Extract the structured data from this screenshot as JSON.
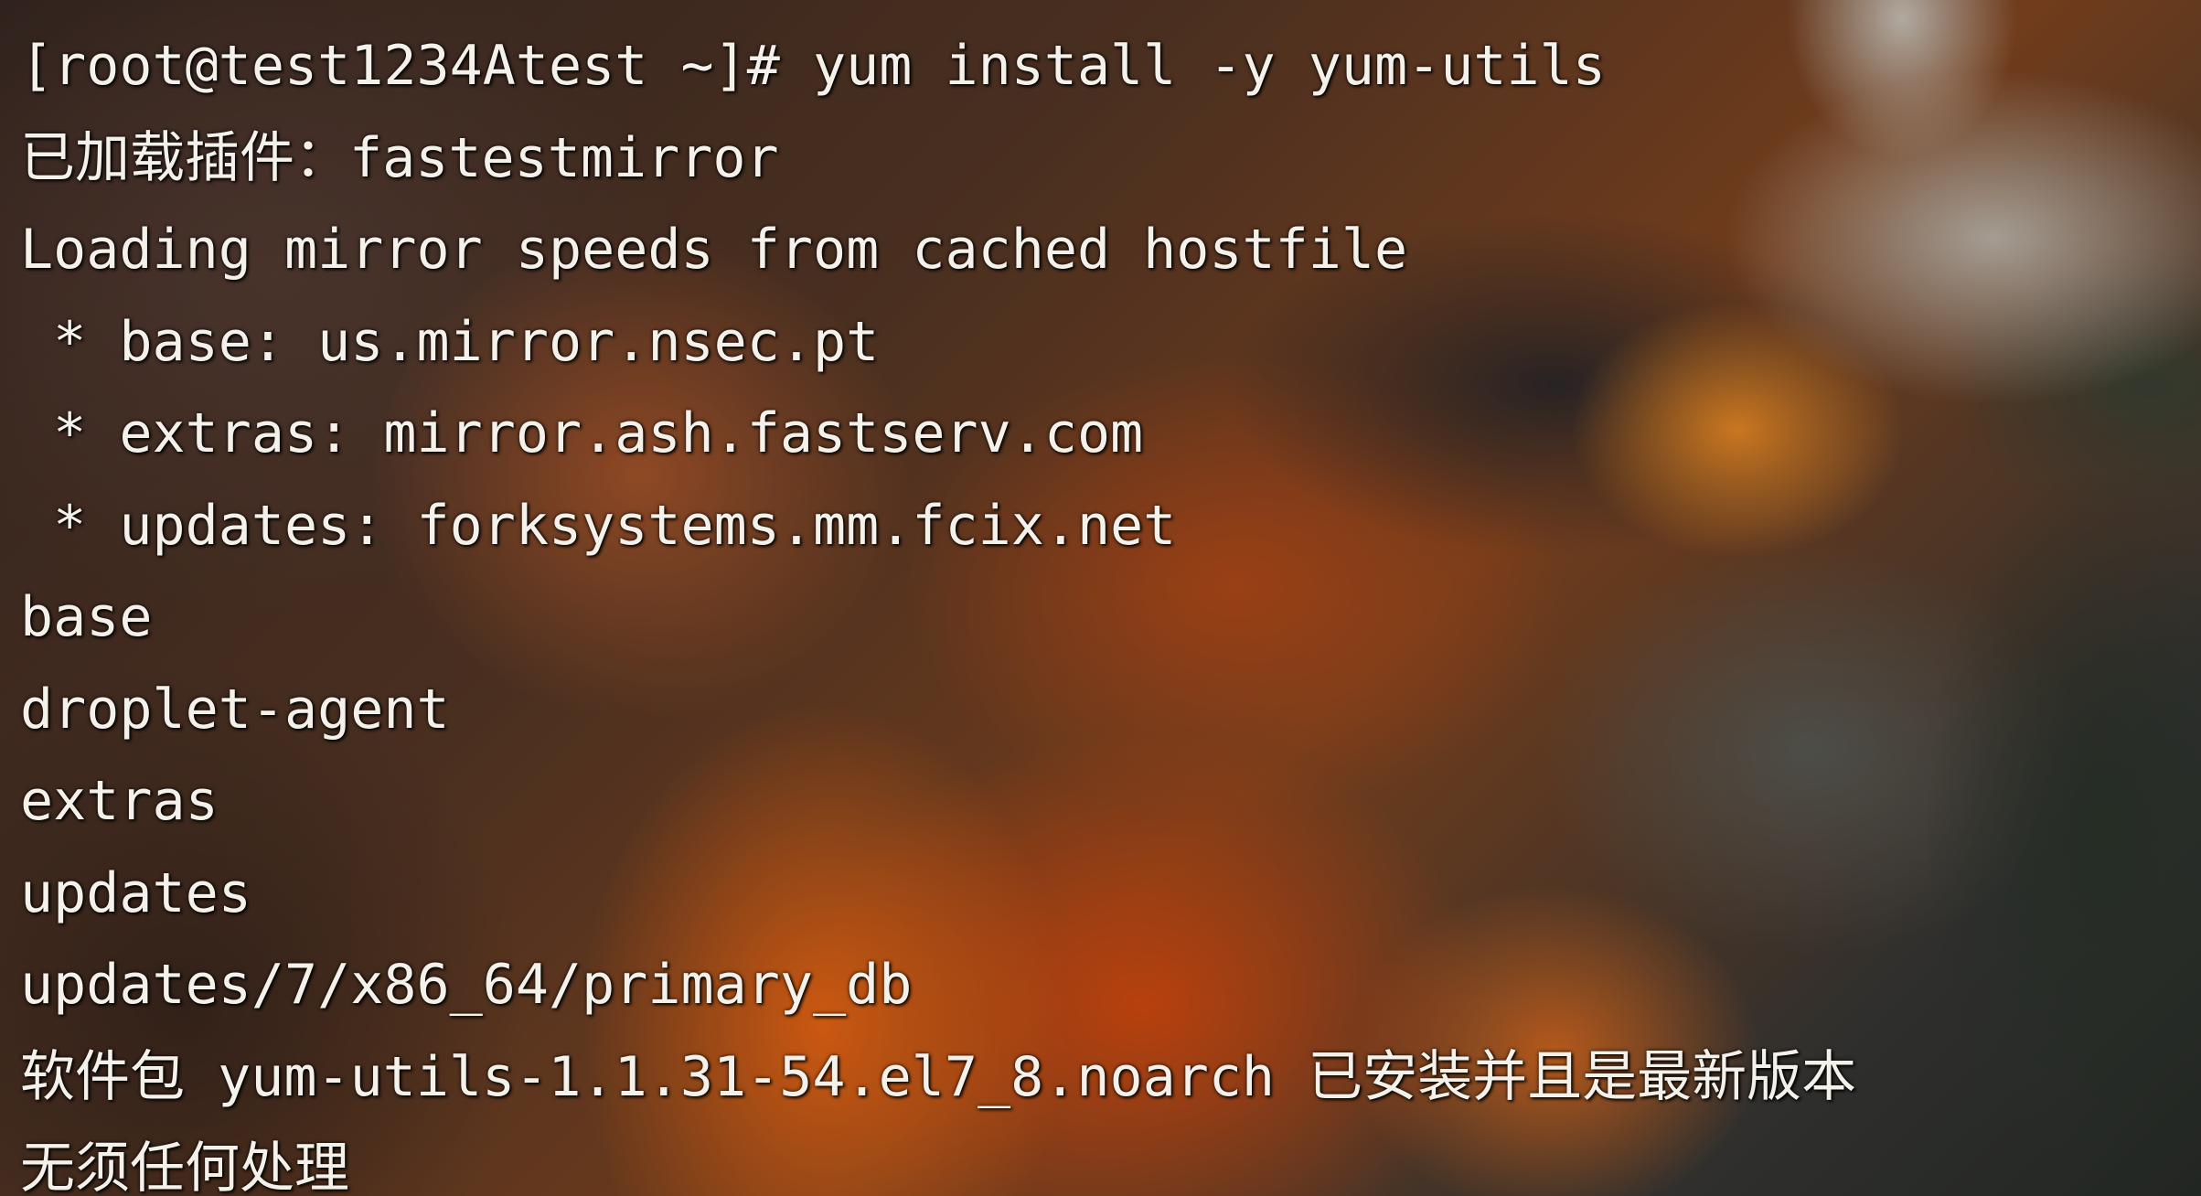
{
  "terminal": {
    "lines": [
      "[root@test1234Atest ~]# yum install -y yum-utils",
      "已加载插件：fastestmirror",
      "Loading mirror speeds from cached hostfile",
      " * base: us.mirror.nsec.pt",
      " * extras: mirror.ash.fastserv.com",
      " * updates: forksystems.mm.fcix.net",
      "base",
      "droplet-agent",
      "extras",
      "updates",
      "updates/7/x86_64/primary_db",
      "软件包 yum-utils-1.1.31-54.el7_8.noarch 已安装并且是最新版本",
      "无须任何处理"
    ]
  }
}
